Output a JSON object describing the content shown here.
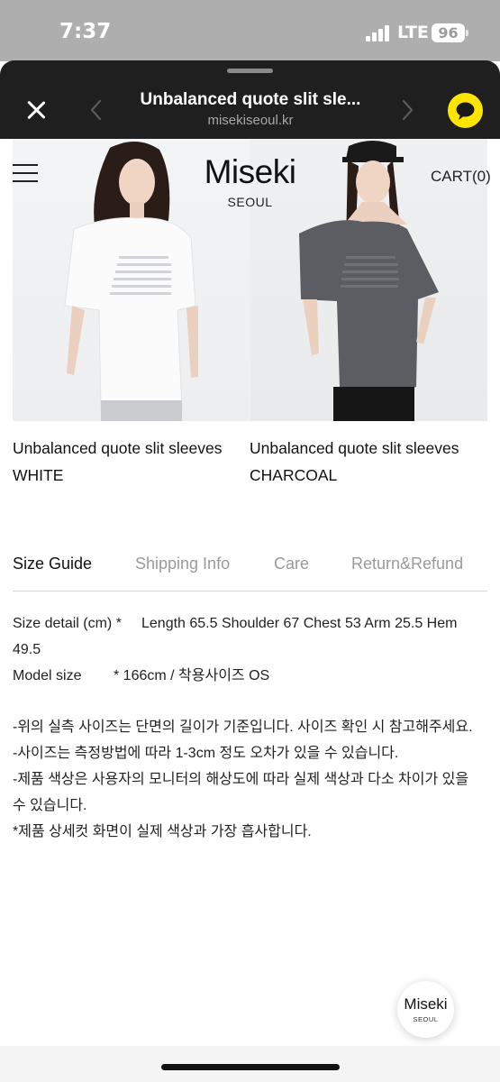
{
  "status_bar": {
    "time": "7:37",
    "network": "LTE",
    "battery": "96"
  },
  "browser": {
    "title": "Unbalanced quote slit sle...",
    "url": "misekiseoul.kr",
    "close_icon": "close-icon",
    "back_icon": "chevron-left-icon",
    "forward_icon": "chevron-right-icon",
    "chat_icon": "kakao-chat-icon",
    "chat_color": "#fee500"
  },
  "site": {
    "logo": "Miseki",
    "logo_sub": "SEOUL",
    "cart": "CART(0)",
    "menu_icon": "hamburger-icon"
  },
  "products": [
    {
      "name_line1": "Unbalanced quote slit sleeves",
      "name_line2": "WHITE"
    },
    {
      "name_line1": "Unbalanced quote slit sleeves",
      "name_line2": "CHARCOAL"
    }
  ],
  "tabs": [
    {
      "label": "Size Guide",
      "active": true
    },
    {
      "label": "Shipping Info",
      "active": false
    },
    {
      "label": "Care",
      "active": false
    },
    {
      "label": "Return&Refund",
      "active": false
    }
  ],
  "size_guide": {
    "detail_label": "Size detail (cm) *",
    "detail_value_line1": "Length 65.5 Shoulder 67 Chest 53 Arm 25.5 Hem",
    "detail_value_line2": "49.5",
    "model_label": "Model size",
    "model_value": "*  166cm / 착용사이즈 OS",
    "notes": [
      "-위의 실측 사이즈는 단면의 길이가 기준입니다. 사이즈 확인 시 참고해주세요.",
      "-사이즈는 측정방법에 따라 1-3cm 정도 오차가 있을 수 있습니다.",
      "-제품 색상은 사용자의 모니터의 해상도에 따라 실제 색상과 다소 차이가 있을",
      "수 있습니다.",
      "*제품 상세컷 화면이 실제 색상과 가장 흡사합니다."
    ]
  },
  "floating_logo": {
    "main": "Miseki",
    "sub": "SEOUL"
  }
}
